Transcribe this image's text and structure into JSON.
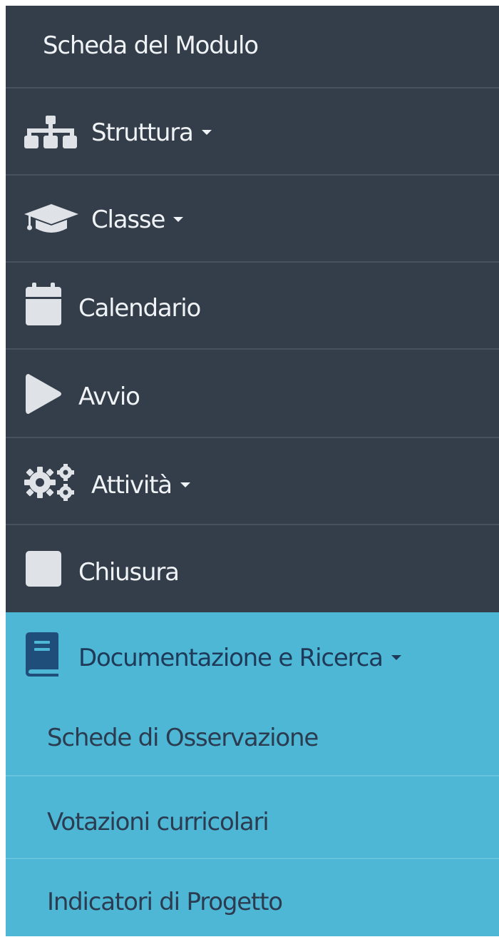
{
  "menu": {
    "header_label": "Scheda del Modulo",
    "items": [
      {
        "label": "Struttura",
        "icon": "sitemap-icon",
        "has_dropdown": true
      },
      {
        "label": "Classe",
        "icon": "graduation-cap-icon",
        "has_dropdown": true
      },
      {
        "label": "Calendario",
        "icon": "calendar-icon",
        "has_dropdown": false
      },
      {
        "label": "Avvio",
        "icon": "play-icon",
        "has_dropdown": false
      },
      {
        "label": "Attività",
        "icon": "gears-icon",
        "has_dropdown": true
      },
      {
        "label": "Chiusura",
        "icon": "stop-icon",
        "has_dropdown": false
      }
    ],
    "active_section": {
      "label": "Documentazione e Ricerca",
      "icon": "book-icon",
      "has_dropdown": true,
      "subitems": [
        {
          "label": "Schede di Osservazione"
        },
        {
          "label": "Votazioni curricolari"
        },
        {
          "label": "Indicatori di Progetto"
        }
      ]
    }
  },
  "colors": {
    "sidebar_bg": "#343e4a",
    "text_light": "#f0f3f6",
    "icon_light": "#dfe3e8",
    "active_bg": "#4eb7d6",
    "active_text": "#1e3a58",
    "book_icon": "#1f4e7a"
  }
}
